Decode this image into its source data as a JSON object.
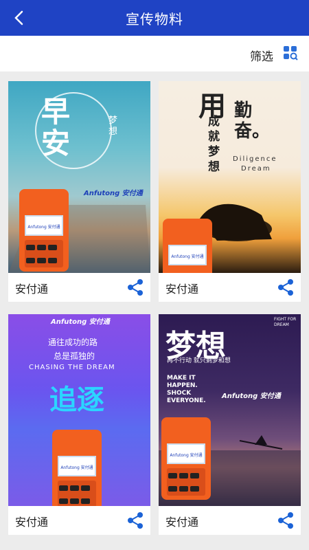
{
  "header": {
    "title": "宣传物料"
  },
  "filter": {
    "label": "筛选"
  },
  "colors": {
    "brand": "#1f43c4",
    "share": "#1b62d6"
  },
  "posters": [
    {
      "label": "安付通",
      "big_text": "早安",
      "vertical": "梦想",
      "brand_text": "Anfutong 安付通",
      "screen_brand": "Anfutong 安付通"
    },
    {
      "label": "安付通",
      "big_text": "用",
      "line1": "成就梦想",
      "line2": "勤奋。",
      "en1": "Diligence",
      "en2": "Dream",
      "screen_brand": "Anfutong 安付通"
    },
    {
      "label": "安付通",
      "brand_text": "Anfutong 安付通",
      "line1": "通往成功的路",
      "line2": "总是孤独的",
      "en": "CHASING THE DREAM",
      "big_text": "追逐",
      "screen_brand": "Anfutong 安付通"
    },
    {
      "label": "安付通",
      "big_text": "梦想",
      "sub": "再不行动 就只剩梦和想",
      "en": "MAKE IT HAPPEN. SHOCK EVERYONE.",
      "fight": "FIGHT FOR DREAM",
      "brand_text": "Anfutong 安付通",
      "screen_brand": "Anfutong 安付通"
    }
  ]
}
